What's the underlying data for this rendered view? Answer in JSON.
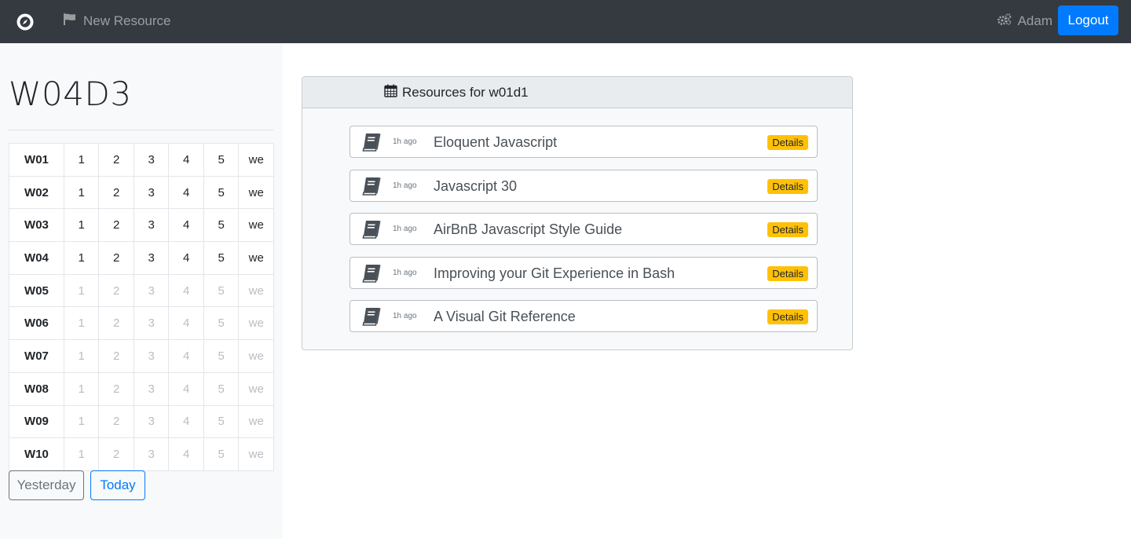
{
  "navbar": {
    "brand_icon": "compass-icon",
    "new_resource_label": "New Resource",
    "new_resource_icon": "flag-icon",
    "user_icon": "cogs-icon",
    "user_name": "Adam",
    "logout_label": "Logout"
  },
  "sidebar": {
    "title": "W04D3",
    "weeks": [
      {
        "label": "W01",
        "days": [
          "1",
          "2",
          "3",
          "4",
          "5",
          "we"
        ],
        "enabled": true
      },
      {
        "label": "W02",
        "days": [
          "1",
          "2",
          "3",
          "4",
          "5",
          "we"
        ],
        "enabled": true
      },
      {
        "label": "W03",
        "days": [
          "1",
          "2",
          "3",
          "4",
          "5",
          "we"
        ],
        "enabled": true
      },
      {
        "label": "W04",
        "days": [
          "1",
          "2",
          "3",
          "4",
          "5",
          "we"
        ],
        "enabled": true
      },
      {
        "label": "W05",
        "days": [
          "1",
          "2",
          "3",
          "4",
          "5",
          "we"
        ],
        "enabled": false
      },
      {
        "label": "W06",
        "days": [
          "1",
          "2",
          "3",
          "4",
          "5",
          "we"
        ],
        "enabled": false
      },
      {
        "label": "W07",
        "days": [
          "1",
          "2",
          "3",
          "4",
          "5",
          "we"
        ],
        "enabled": false
      },
      {
        "label": "W08",
        "days": [
          "1",
          "2",
          "3",
          "4",
          "5",
          "we"
        ],
        "enabled": false
      },
      {
        "label": "W09",
        "days": [
          "1",
          "2",
          "3",
          "4",
          "5",
          "we"
        ],
        "enabled": false
      },
      {
        "label": "W10",
        "days": [
          "1",
          "2",
          "3",
          "4",
          "5",
          "we"
        ],
        "enabled": false
      }
    ],
    "yesterday_label": "Yesterday",
    "today_label": "Today"
  },
  "card": {
    "header_icon": "calendar-icon",
    "header_title": "Resources for w01d1",
    "resources": [
      {
        "icon": "book-icon",
        "time": "1h ago",
        "title": "Eloquent Javascript",
        "badge": "Details"
      },
      {
        "icon": "book-icon",
        "time": "1h ago",
        "title": "Javascript 30",
        "badge": "Details"
      },
      {
        "icon": "book-icon",
        "time": "1h ago",
        "title": "AirBnB Javascript Style Guide",
        "badge": "Details"
      },
      {
        "icon": "book-icon",
        "time": "1h ago",
        "title": "Improving your Git Experience in Bash",
        "badge": "Details"
      },
      {
        "icon": "book-icon",
        "time": "1h ago",
        "title": "A Visual Git Reference",
        "badge": "Details"
      }
    ]
  },
  "colors": {
    "navbar_bg": "#343a40",
    "primary": "#007bff",
    "badge_warning": "#ffc107",
    "sidebar_bg": "#f8f9fa"
  }
}
